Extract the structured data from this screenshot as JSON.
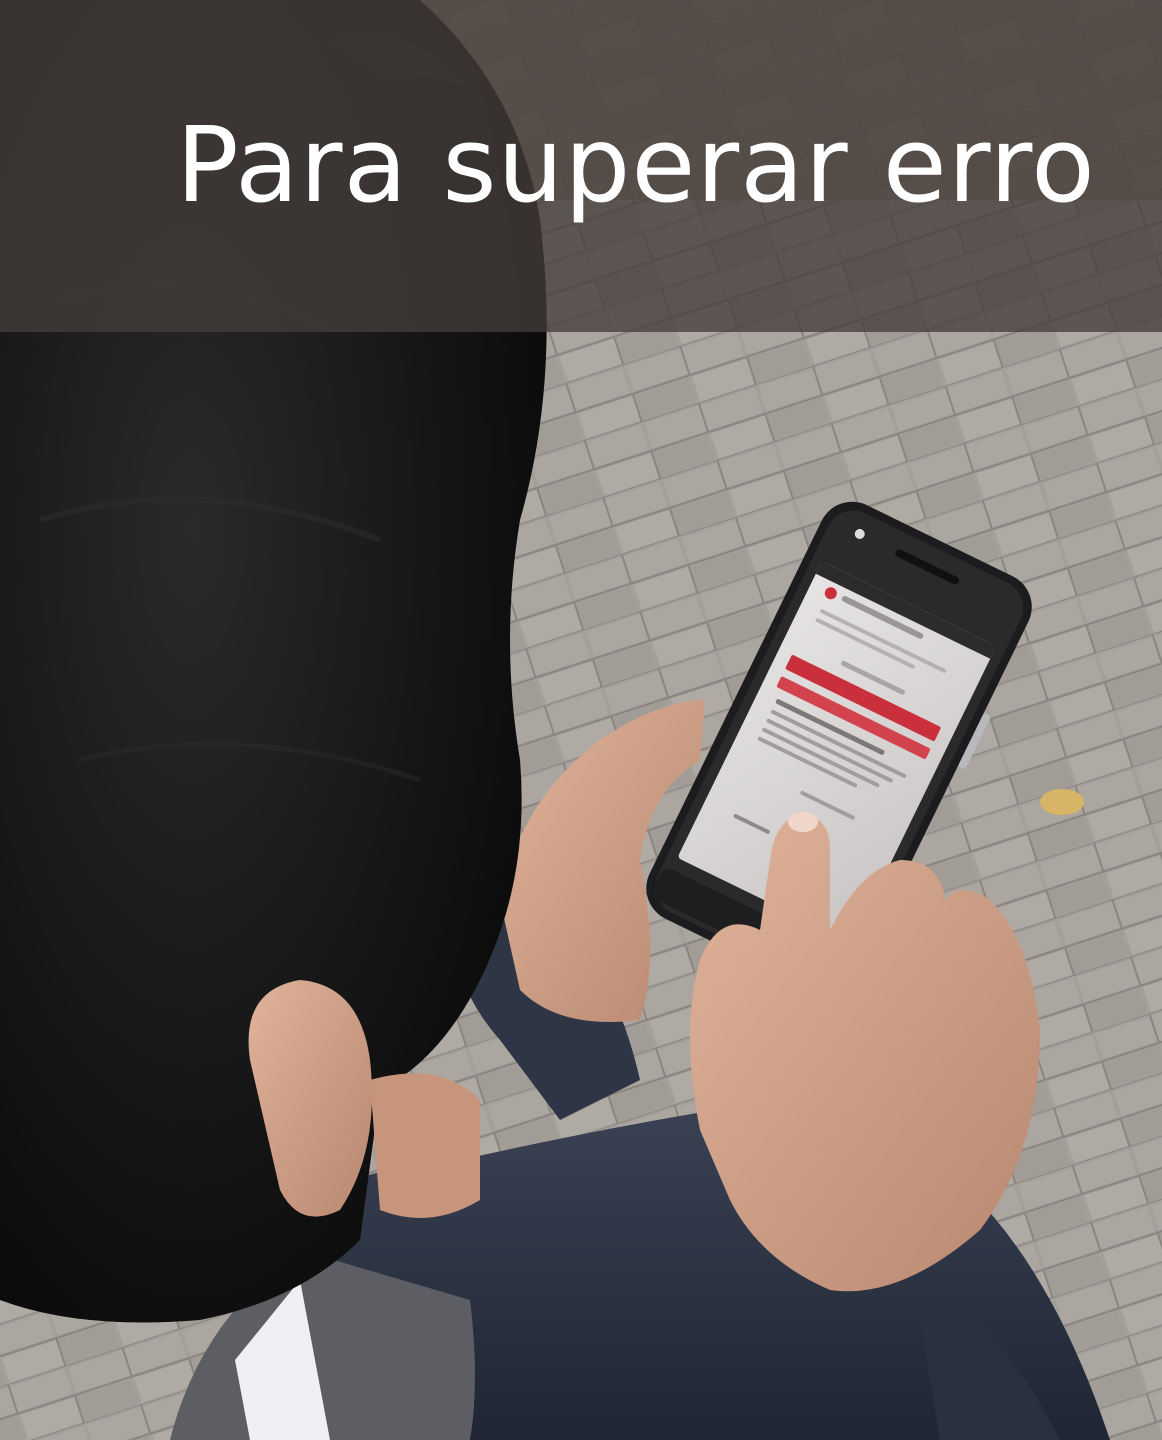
{
  "caption": {
    "text": "Para superar erro"
  },
  "photo": {
    "subject": "person-with-smartphone-icon",
    "colors": {
      "caption_band": "#443e3a",
      "caption_text": "#ffffff",
      "pavement": "#a7a19c",
      "hair": "#141414",
      "skin": "#c89a82",
      "jacket": "#2b3446",
      "phone_body": "#1c1c1e",
      "phone_screen": "#d9d6d6",
      "screen_accent": "#c9303b"
    }
  }
}
